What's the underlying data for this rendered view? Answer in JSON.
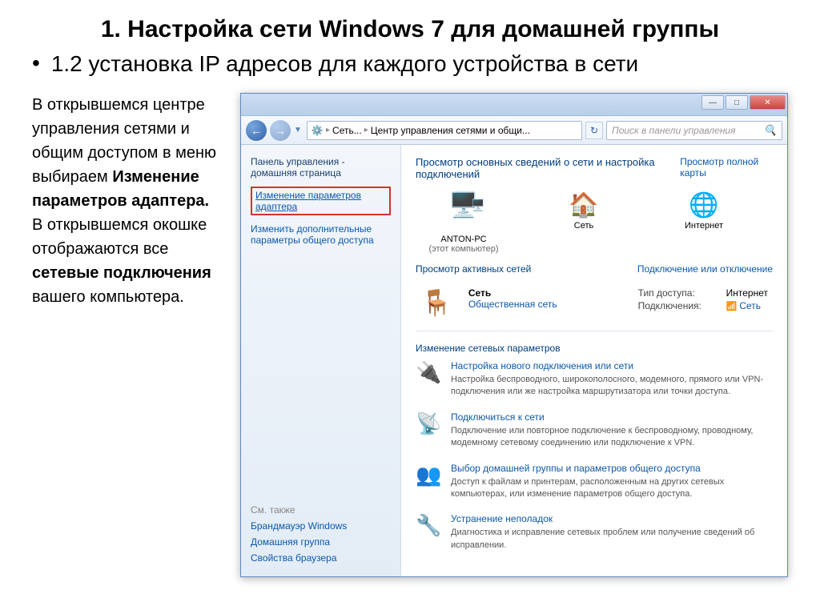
{
  "slide": {
    "title": "1. Настройка сети Windows 7 для домашней группы",
    "subtitle": "1.2 установка IP адресов для каждого устройства в сети",
    "bullet": "•"
  },
  "instructions": {
    "p1a": "В открывшемся центре управления сетями и общим доступом в меню выбираем ",
    "p1b": "Изменение параметров адаптера.",
    "p2a": " В открывшемся окошке отображаются все ",
    "p2b": "сетевые подключения",
    "p2c": " вашего компьютера."
  },
  "window": {
    "btn_min": "—",
    "btn_max": "□",
    "btn_close": "✕",
    "nav_back": "←",
    "nav_fwd": "→",
    "nav_drop": "▼",
    "breadcrumb": {
      "root_sep": "▸",
      "part1": "Сеть...",
      "sep": "▸",
      "part2": "Центр управления сетями и общи...",
      "refresh": "↻"
    },
    "search_placeholder": "Поиск в панели управления",
    "search_icon": "🔍"
  },
  "sidebar": {
    "heading1": "Панель управления -",
    "heading2": "домашняя страница",
    "link_adapter": "Изменение параметров адаптера",
    "link_sharing": "Изменить дополнительные параметры общего доступа",
    "footer_label": "См. также",
    "footer_fw": "Брандмауэр Windows",
    "footer_hg": "Домашняя группа",
    "footer_ie": "Свойства браузера"
  },
  "main": {
    "heading": "Просмотр основных сведений о сети и настройка подключений",
    "map_link": "Просмотр полной карты",
    "nodes": {
      "pc_icon": "🖥️",
      "pc_name": "ANTON-PC",
      "pc_sub": "(этот компьютер)",
      "net_icon": "🏠",
      "net_name": "Сеть",
      "inet_icon": "🌐",
      "inet_name": "Интернет",
      "multi_icon": "🖥️"
    },
    "active_label": "Просмотр активных сетей",
    "active_right": "Подключение или отключение",
    "active": {
      "bench": "🪑",
      "name": "Сеть",
      "type": "Общественная сеть",
      "access_key": "Тип доступа:",
      "access_val": "Интернет",
      "conn_key": "Подключения:",
      "conn_val": "Сеть",
      "sig": "📶"
    },
    "change_label": "Изменение сетевых параметров",
    "items": [
      {
        "icon": "🔌",
        "title": "Настройка нового подключения или сети",
        "desc": "Настройка беспроводного, широкополосного, модемного, прямого или VPN-подключения или же настройка маршрутизатора или точки доступа."
      },
      {
        "icon": "📡",
        "title": "Подключиться к сети",
        "desc": "Подключение или повторное подключение к беспроводному, проводному, модемному сетевому соединению или подключение к VPN."
      },
      {
        "icon": "👥",
        "title": "Выбор домашней группы и параметров общего доступа",
        "desc": "Доступ к файлам и принтерам, расположенным на других сетевых компьютерах, или изменение параметров общего доступа."
      },
      {
        "icon": "🔧",
        "title": "Устранение неполадок",
        "desc": "Диагностика и исправление сетевых проблем или получение сведений об исправлении."
      }
    ]
  }
}
